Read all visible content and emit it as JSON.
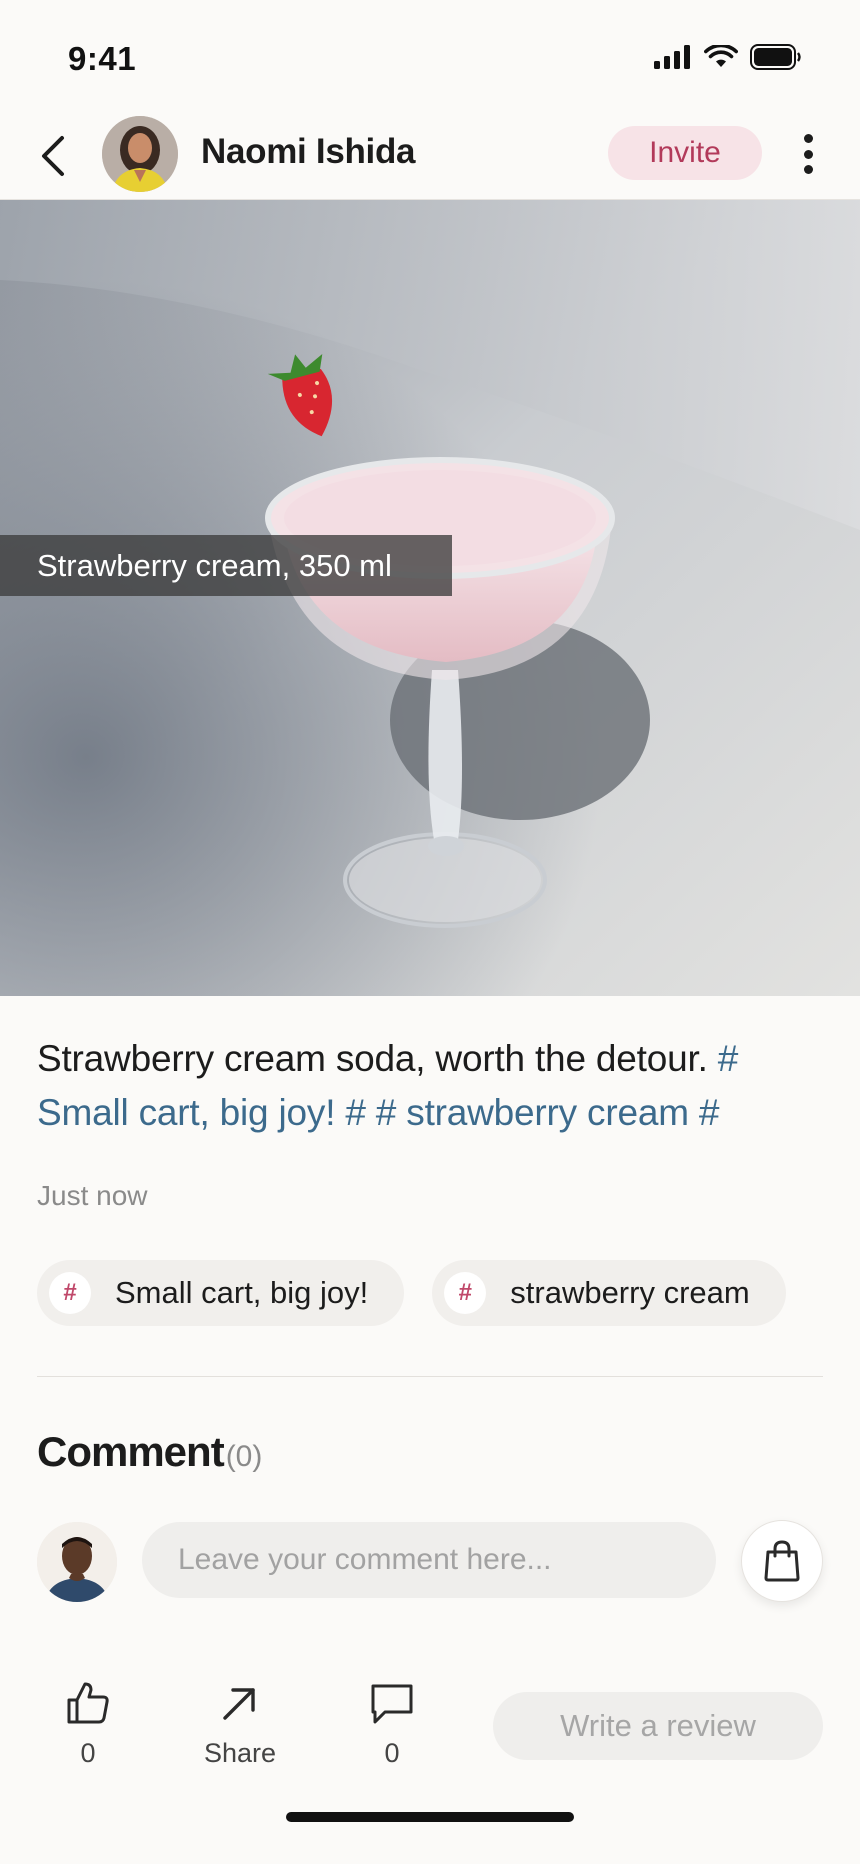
{
  "status_bar": {
    "time": "9:41"
  },
  "header": {
    "author_name": "Naomi Ishida",
    "invite_label": "Invite"
  },
  "post": {
    "image_tag": "Strawberry cream, 350 ml",
    "caption_text": "Strawberry cream soda, worth the detour. ",
    "caption_hashtags": "# Small cart, big joy! # # strawberry cream #",
    "timestamp": "Just now",
    "topics": [
      {
        "hash": "#",
        "label": "Small cart, big joy!"
      },
      {
        "hash": "#",
        "label": "strawberry cream"
      }
    ]
  },
  "comments": {
    "title": "Comment",
    "count": "(0)",
    "input_placeholder": "Leave your comment here..."
  },
  "actions": {
    "like_count": "0",
    "share_label": "Share",
    "comment_count": "0",
    "review_label": "Write a review"
  },
  "colors": {
    "accent": "#b23a5a",
    "hashtag": "#3c6a8c",
    "background": "#fbfaf8"
  }
}
